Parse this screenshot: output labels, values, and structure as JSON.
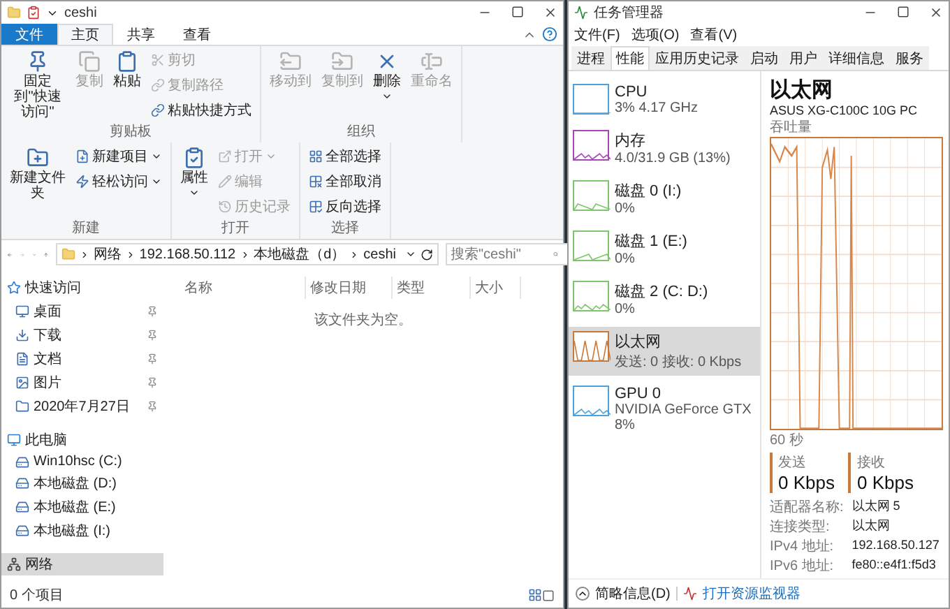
{
  "explorer": {
    "title": "ceshi",
    "tabs": [
      {
        "label": "文件",
        "kind": "file",
        "selected": false
      },
      {
        "label": "主页",
        "kind": "tab",
        "selected": true
      },
      {
        "label": "共享",
        "kind": "tab",
        "selected": false
      },
      {
        "label": "查看",
        "kind": "tab",
        "selected": false
      }
    ],
    "ribbon": [
      {
        "label": "剪贴板",
        "items": [
          {
            "label": "固定到\"快速访问\"",
            "kind": "large",
            "disabled": false
          },
          {
            "label": "复制",
            "kind": "large",
            "disabled": true
          },
          {
            "label": "粘贴",
            "kind": "large",
            "disabled": false
          },
          {
            "label": "剪切",
            "kind": "small",
            "disabled": true
          },
          {
            "label": "复制路径",
            "kind": "small",
            "disabled": true
          },
          {
            "label": "粘贴快捷方式",
            "kind": "small",
            "disabled": false
          }
        ]
      },
      {
        "label": "组织",
        "items": [
          {
            "label": "移动到",
            "kind": "large",
            "disabled": true
          },
          {
            "label": "复制到",
            "kind": "large",
            "disabled": true
          },
          {
            "label": "删除",
            "kind": "large",
            "disabled": false,
            "has_menu": true
          },
          {
            "label": "重命名",
            "kind": "large",
            "disabled": true
          }
        ]
      },
      {
        "label": "新建",
        "items": [
          {
            "label": "新建文件夹",
            "kind": "large",
            "disabled": false
          },
          {
            "label": "新建项目",
            "kind": "small",
            "disabled": false,
            "has_menu": true
          },
          {
            "label": "轻松访问",
            "kind": "small",
            "disabled": false,
            "has_menu": true
          }
        ]
      },
      {
        "label": "打开",
        "items": [
          {
            "label": "属性",
            "kind": "large",
            "disabled": false,
            "has_menu": true
          },
          {
            "label": "打开",
            "kind": "small",
            "disabled": true,
            "has_menu": true
          },
          {
            "label": "编辑",
            "kind": "small",
            "disabled": true
          },
          {
            "label": "历史记录",
            "kind": "small",
            "disabled": true
          }
        ]
      },
      {
        "label": "选择",
        "items": [
          {
            "label": "全部选择",
            "kind": "small",
            "disabled": false
          },
          {
            "label": "全部取消",
            "kind": "small",
            "disabled": false
          },
          {
            "label": "反向选择",
            "kind": "small",
            "disabled": false
          }
        ]
      }
    ],
    "breadcrumb": [
      "网络",
      "192.168.50.112",
      "本地磁盘（d）",
      "ceshi"
    ],
    "search": {
      "placeholder": "搜索\"ceshi\""
    },
    "sidebar": [
      {
        "label": "快速访问",
        "selected": false,
        "children": [
          {
            "label": "桌面",
            "pinned": true,
            "selected": false
          },
          {
            "label": "下载",
            "pinned": true,
            "selected": false
          },
          {
            "label": "文档",
            "pinned": true,
            "selected": false
          },
          {
            "label": "图片",
            "pinned": true,
            "selected": false
          },
          {
            "label": "2020年7月27日",
            "pinned": true,
            "selected": false
          }
        ]
      },
      {
        "label": "此电脑",
        "selected": false,
        "children": [
          {
            "label": "Win10hsc (C:)",
            "pinned": false,
            "selected": false
          },
          {
            "label": "本地磁盘 (D:)",
            "pinned": false,
            "selected": false
          },
          {
            "label": "本地磁盘 (E:)",
            "pinned": false,
            "selected": false
          },
          {
            "label": "本地磁盘 (I:)",
            "pinned": false,
            "selected": false
          }
        ]
      },
      {
        "label": "网络",
        "selected": true
      }
    ],
    "columns": [
      "名称",
      "修改日期",
      "类型",
      "大小"
    ],
    "empty_message": "该文件夹为空。",
    "status": "0 个项目"
  },
  "task_manager": {
    "title": "任务管理器",
    "menu": [
      "文件(F)",
      "选项(O)",
      "查看(V)"
    ],
    "tabs": [
      {
        "label": "进程",
        "selected": false
      },
      {
        "label": "性能",
        "selected": true
      },
      {
        "label": "应用历史记录",
        "selected": false
      },
      {
        "label": "启动",
        "selected": false
      },
      {
        "label": "用户",
        "selected": false
      },
      {
        "label": "详细信息",
        "selected": false
      },
      {
        "label": "服务",
        "selected": false
      }
    ],
    "resources": [
      {
        "name": "CPU",
        "details": [
          "3% 4.17 GHz"
        ],
        "color": "#4aa3df",
        "selected": false
      },
      {
        "name": "内存",
        "details": [
          "4.0/31.9 GB (13%)"
        ],
        "color": "#a845b8",
        "selected": false
      },
      {
        "name": "磁盘 0 (I:)",
        "details": [
          "0%"
        ],
        "color": "#7dc66b",
        "selected": false
      },
      {
        "name": "磁盘 1 (E:)",
        "details": [
          "0%"
        ],
        "color": "#7dc66b",
        "selected": false
      },
      {
        "name": "磁盘 2 (C: D:)",
        "details": [
          "0%"
        ],
        "color": "#7dc66b",
        "selected": false
      },
      {
        "name": "以太网",
        "details": [
          "发送: 0 接收: 0 Kbps"
        ],
        "color": "#c87a3c",
        "selected": true
      },
      {
        "name": "GPU 0",
        "details": [
          "NVIDIA GeForce GTX",
          "8%"
        ],
        "color": "#4aa3df",
        "selected": false
      }
    ],
    "detail": {
      "title": "以太网",
      "device": "ASUS XG-C100C 10G PC",
      "graph_label": "吞吐量",
      "time_label": "60 秒",
      "stats": [
        {
          "label": "发送",
          "value": "0 Kbps"
        },
        {
          "label": "接收",
          "value": "0 Kbps"
        }
      ],
      "properties": [
        {
          "label": "适配器名称:",
          "value": "以太网 5"
        },
        {
          "label": "连接类型:",
          "value": "以太网"
        },
        {
          "label": "IPv4 地址:",
          "value": "192.168.50.127"
        },
        {
          "label": "IPv6 地址:",
          "value": "fe80::e4f1:f5d3"
        }
      ]
    },
    "footer": {
      "collapse": "简略信息(D)",
      "link": "打开资源监视器"
    }
  }
}
